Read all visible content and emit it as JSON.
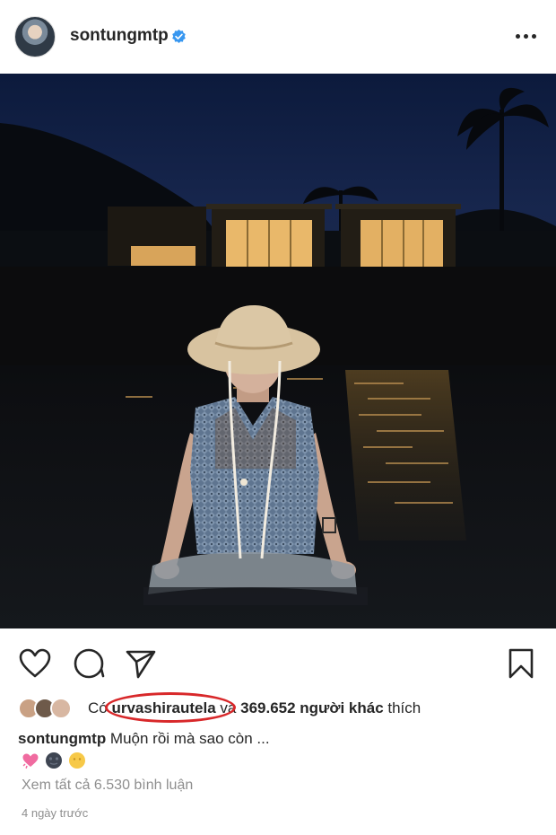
{
  "post": {
    "username": "sontungmtp",
    "verified_icon": "verified-badge-icon",
    "more_icon": "more-options-icon"
  },
  "photo": {
    "semantic": "night-beach-photo"
  },
  "actions": {
    "like_icon": "heart-icon",
    "comment_icon": "comment-icon",
    "share_icon": "send-icon",
    "save_icon": "bookmark-icon"
  },
  "likes": {
    "prefix": "Có ",
    "liker": "urvashirautela",
    "middle": " và ",
    "count": "369.652 người khác",
    "suffix": " thích"
  },
  "caption": {
    "username": "sontungmtp",
    "text": " Muộn rồi mà sao còn ..."
  },
  "emojis": [
    "sparkling-heart-emoji",
    "new-moon-face-emoji",
    "yellow-face-emoji"
  ],
  "comments": {
    "view_all": "Xem tất cả 6.530 bình luận"
  },
  "timestamp": "4 ngày trước",
  "colors": {
    "accent_blue": "#3897f0",
    "annotation_red": "#d8282a",
    "muted": "#8e8e8e"
  }
}
